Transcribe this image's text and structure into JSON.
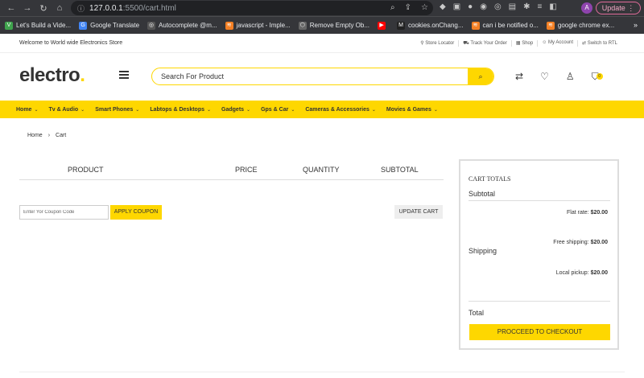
{
  "browser": {
    "url_host": "127.0.0.1",
    "url_path": ":5500/cart.html",
    "update_label": "Update",
    "avatar_letter": "A",
    "bookmarks": [
      {
        "label": "Let's Build a Vide...",
        "color": "#3fa34d",
        "glyph": "V"
      },
      {
        "label": "Google Translate",
        "color": "#4285f4",
        "glyph": "G"
      },
      {
        "label": "Autocomplete @m...",
        "color": "#555555",
        "glyph": "◎"
      },
      {
        "label": "javascript - Imple...",
        "color": "#f48024",
        "glyph": "≋"
      },
      {
        "label": "Remove Empty Ob...",
        "color": "#666666",
        "glyph": "⬡"
      },
      {
        "label": "",
        "color": "#ff0000",
        "glyph": "▶"
      },
      {
        "label": "cookies.onChang...",
        "color": "#222222",
        "glyph": "M"
      },
      {
        "label": "can i be notified o...",
        "color": "#f48024",
        "glyph": "≋"
      },
      {
        "label": "google chrome ex...",
        "color": "#f48024",
        "glyph": "≋"
      }
    ],
    "bookmarks_more": "»"
  },
  "topbar": {
    "welcome": "Welcome to World wide Electronics Store",
    "links": [
      "Store Locator",
      "Track Your Order",
      "Shop",
      "My Account",
      "Switch to RTL"
    ]
  },
  "header": {
    "logo_text": "electro",
    "logo_dot": ".",
    "search_placeholder": "Search For Product",
    "cart_count": "0"
  },
  "menu": [
    "Home",
    "Tv & Audio",
    "Smart Phones",
    "Labtops & Desktops",
    "Gadgets",
    "Gps & Car",
    "Cameras & Accessories",
    "Movies & Games"
  ],
  "breadcrumb": {
    "home": "Home",
    "sep": "›",
    "current": "Cart"
  },
  "cart_table": {
    "product": "PRODUCT",
    "price": "PRICE",
    "quantity": "QUANTITY",
    "subtotal": "SUBTOTAL"
  },
  "coupon": {
    "placeholder": "Enter Yor Coupon Code",
    "apply_label": "APPLY COUPON",
    "update_label": "UPDATE CART"
  },
  "totals": {
    "title": "CART TOTALS",
    "subtotal_label": "Subtotal",
    "shipping_label": "Shipping",
    "total_label": "Total",
    "shipping_options": [
      {
        "name": "Flat rate:",
        "price": "$20.00"
      },
      {
        "name": "Free shipping:",
        "price": "$20.00"
      },
      {
        "name": "Local pickup:",
        "price": "$20.00"
      }
    ],
    "checkout_label": "PROCCEED TO CHECKOUT"
  },
  "colors": {
    "accent": "#fed700"
  }
}
